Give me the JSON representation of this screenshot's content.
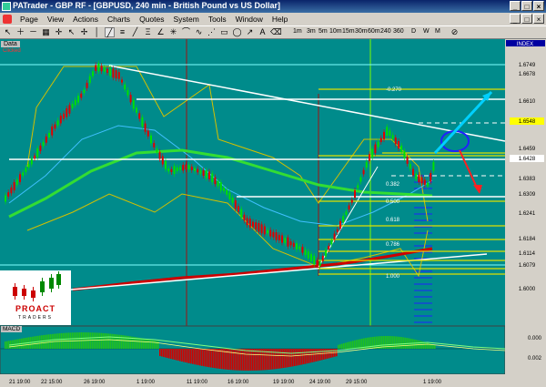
{
  "window": {
    "title": "PATrader - GBP RF - [GBPUSD, 240 min - British Pound vs US Dollar]"
  },
  "menu": [
    "Page",
    "View",
    "Actions",
    "Charts",
    "Quotes",
    "System",
    "Tools",
    "Window",
    "Help"
  ],
  "timeframes": [
    "1m",
    "3m",
    "5m",
    "10m",
    "15m",
    "30m",
    "60m",
    "240",
    "360",
    "D",
    "W",
    "M"
  ],
  "panel": {
    "label": "Data",
    "sublabel": "Clicked"
  },
  "price_axis": {
    "header": "INDEX",
    "labels": [
      "1.6749",
      "1.6678",
      "1.6610",
      "1.6548",
      "1.6459",
      "1.6428",
      "1.6383",
      "1.6309",
      "1.6241",
      "1.6184",
      "1.6114",
      "1.6079",
      "1.6000"
    ]
  },
  "fib_labels": [
    "-0.270",
    "0.382",
    "0.500",
    "0.618",
    "0.786",
    "1.000"
  ],
  "date_axis": [
    "21 19:00",
    "22 15:00",
    "26 19:00",
    "1 19:00",
    "11 19:00",
    "16 19:00",
    "19 19:00",
    "24 19:00",
    "29 15:00",
    "1 19:00"
  ],
  "macd": {
    "label": "MACD",
    "levels": [
      "0.000",
      "0.002"
    ]
  },
  "logo": {
    "name": "PROACT",
    "sub": "TRADERS"
  },
  "colors": {
    "background": "#008B8B",
    "candle_up": "#00E000",
    "candle_down": "#E00000",
    "ma_green": "#33DD33",
    "ma_red": "#CC0000",
    "fib": "#FFFF00",
    "arrow_up": "#00D0FF",
    "arrow_down": "#FF2020"
  }
}
